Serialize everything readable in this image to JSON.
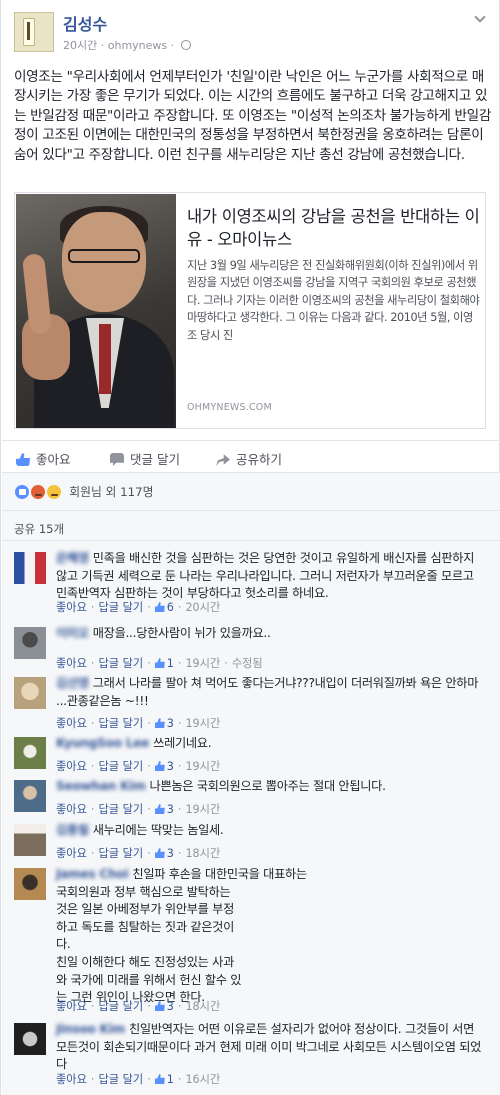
{
  "post": {
    "author": "김성수",
    "time": "20시간",
    "source": "ohmynews",
    "text": "이영조는 \"우리사회에서 언제부터인가 '친일'이란 낙인은 어느 누군가를 사회적으로 매장시키는 가장 좋은 무기가 되었다. 이는 시간의 흐름에도 불구하고 더욱 강고해지고 있는 반일감정 때문\"이라고 주장합니다. 또 이영조는 \"이성적 논의조차 불가능하게 반일감정이 고조된 이면에는 대한민국의 정통성을 부정하면서 북한정권을 옹호하려는 담론이 숨어 있다\"고 주장합니다. 이런 친구를 새누리당은 지난 총선 강남에 공천했습니다."
  },
  "link": {
    "title": "내가 이영조씨의 강남을 공천을 반대하는 이유 - 오마이뉴스",
    "description": "지난 3월 9일 새누리당은 전 진실화해위원회(이하 진실위)에서 위원장을 지냈던 이영조씨를 강남을 지역구 국회의원 후보로 공천했다. 그러나 기자는 이러한 이영조씨의 공천을 새누리당이 철회해야 마땅하다고 생각한다. 그 이유는 다음과 같다. 2010년 5월, 이영조 당시 진",
    "domain": "OHMYNEWS.COM"
  },
  "actions": {
    "like": "좋아요",
    "comment": "댓글 달기",
    "share": "공유하기"
  },
  "reactions": {
    "count_text": "회원님 외 117명",
    "types": [
      "like",
      "angry",
      "sad"
    ]
  },
  "shares": {
    "text": "공유 15개"
  },
  "comment_labels": {
    "like": "좋아요",
    "reply": "답글 달기",
    "edited": "수정됨"
  },
  "comments": [
    {
      "name": "은혜영",
      "text": "민족을 배신한 것을 심판하는 것은 당연한 것이고 유일하게 배신자를 심판하지 않고 기득권 세력으로 둔 나라는 우리나라입니다. 그러니 저런자가 부끄러운줄 모르고 민족반역자 심판하는 것이 부당하다고 헛소리를 하네요.",
      "likes": "6",
      "time": "20시간",
      "edited": false
    },
    {
      "name": "이미오",
      "text": "매장을...당한사람이 뉘가 있을까요..",
      "likes": "1",
      "time": "19시간",
      "edited": true
    },
    {
      "name": "김선영",
      "text": "그래서 나라를 팔아 쳐 먹어도 좋다는거냐???내입이 더러워질까봐 욕은 안하마 ...관종같은놈 ~!!!",
      "likes": "3",
      "time": "19시간",
      "edited": false
    },
    {
      "name": "KyungSoo Lee",
      "text": "쓰레기네요.",
      "likes": "3",
      "time": "19시간",
      "edited": false
    },
    {
      "name": "Seowhan Kim",
      "text": "나쁜놈은 국회의원으로 뽑아주는 절대 안됩니다.",
      "likes": "3",
      "time": "19시간",
      "edited": false
    },
    {
      "name": "김종필",
      "text": "새누리에는 딱맞는 놈일세.",
      "likes": "3",
      "time": "18시간",
      "edited": false
    },
    {
      "name": "James Choi",
      "text": "친일파 후손을 대한민국을 대표하는\n국회의원과 정부 핵심으로 발탁하는\n것은 일본 아베정부가 위안부를 부정\n하고 독도를 침탈하는 짓과 같은것이\n다.\n친일 이해한다 해도 진정성있는 사과\n와 국가에 미래를 위해서 헌신 할수 있\n는 그런 위인이 나왔으면 한다.",
      "likes": "3",
      "time": "18시간",
      "edited": false
    },
    {
      "name": "Jinsoo Kim",
      "text": "친일반역자는 어떤 이유로든 설자리가 없어야 정상이다. 그것들이 서면 모든것이 회손되기때문이다 과거 현제 미래 이미 박그네로 사회모든 시스템이오염 되었다",
      "likes": "1",
      "time": "16시간",
      "edited": false
    }
  ],
  "colors": {
    "link_blue": "#365899",
    "like_blue": "#5890ff",
    "meta_gray": "#90949c",
    "feedback_bg": "#f6f7f9"
  }
}
